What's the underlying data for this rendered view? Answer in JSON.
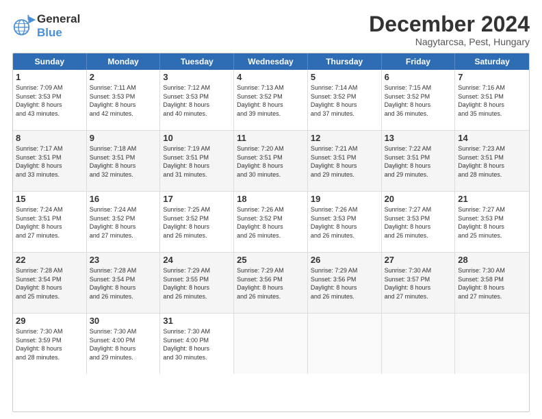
{
  "logo": {
    "line1": "General",
    "line2": "Blue"
  },
  "title": "December 2024",
  "subtitle": "Nagytarcsa, Pest, Hungary",
  "header_days": [
    "Sunday",
    "Monday",
    "Tuesday",
    "Wednesday",
    "Thursday",
    "Friday",
    "Saturday"
  ],
  "rows": [
    [
      {
        "day": "1",
        "info": "Sunrise: 7:09 AM\nSunset: 3:53 PM\nDaylight: 8 hours\nand 43 minutes."
      },
      {
        "day": "2",
        "info": "Sunrise: 7:11 AM\nSunset: 3:53 PM\nDaylight: 8 hours\nand 42 minutes."
      },
      {
        "day": "3",
        "info": "Sunrise: 7:12 AM\nSunset: 3:53 PM\nDaylight: 8 hours\nand 40 minutes."
      },
      {
        "day": "4",
        "info": "Sunrise: 7:13 AM\nSunset: 3:52 PM\nDaylight: 8 hours\nand 39 minutes."
      },
      {
        "day": "5",
        "info": "Sunrise: 7:14 AM\nSunset: 3:52 PM\nDaylight: 8 hours\nand 37 minutes."
      },
      {
        "day": "6",
        "info": "Sunrise: 7:15 AM\nSunset: 3:52 PM\nDaylight: 8 hours\nand 36 minutes."
      },
      {
        "day": "7",
        "info": "Sunrise: 7:16 AM\nSunset: 3:51 PM\nDaylight: 8 hours\nand 35 minutes."
      }
    ],
    [
      {
        "day": "8",
        "info": "Sunrise: 7:17 AM\nSunset: 3:51 PM\nDaylight: 8 hours\nand 33 minutes."
      },
      {
        "day": "9",
        "info": "Sunrise: 7:18 AM\nSunset: 3:51 PM\nDaylight: 8 hours\nand 32 minutes."
      },
      {
        "day": "10",
        "info": "Sunrise: 7:19 AM\nSunset: 3:51 PM\nDaylight: 8 hours\nand 31 minutes."
      },
      {
        "day": "11",
        "info": "Sunrise: 7:20 AM\nSunset: 3:51 PM\nDaylight: 8 hours\nand 30 minutes."
      },
      {
        "day": "12",
        "info": "Sunrise: 7:21 AM\nSunset: 3:51 PM\nDaylight: 8 hours\nand 29 minutes."
      },
      {
        "day": "13",
        "info": "Sunrise: 7:22 AM\nSunset: 3:51 PM\nDaylight: 8 hours\nand 29 minutes."
      },
      {
        "day": "14",
        "info": "Sunrise: 7:23 AM\nSunset: 3:51 PM\nDaylight: 8 hours\nand 28 minutes."
      }
    ],
    [
      {
        "day": "15",
        "info": "Sunrise: 7:24 AM\nSunset: 3:51 PM\nDaylight: 8 hours\nand 27 minutes."
      },
      {
        "day": "16",
        "info": "Sunrise: 7:24 AM\nSunset: 3:52 PM\nDaylight: 8 hours\nand 27 minutes."
      },
      {
        "day": "17",
        "info": "Sunrise: 7:25 AM\nSunset: 3:52 PM\nDaylight: 8 hours\nand 26 minutes."
      },
      {
        "day": "18",
        "info": "Sunrise: 7:26 AM\nSunset: 3:52 PM\nDaylight: 8 hours\nand 26 minutes."
      },
      {
        "day": "19",
        "info": "Sunrise: 7:26 AM\nSunset: 3:53 PM\nDaylight: 8 hours\nand 26 minutes."
      },
      {
        "day": "20",
        "info": "Sunrise: 7:27 AM\nSunset: 3:53 PM\nDaylight: 8 hours\nand 26 minutes."
      },
      {
        "day": "21",
        "info": "Sunrise: 7:27 AM\nSunset: 3:53 PM\nDaylight: 8 hours\nand 25 minutes."
      }
    ],
    [
      {
        "day": "22",
        "info": "Sunrise: 7:28 AM\nSunset: 3:54 PM\nDaylight: 8 hours\nand 25 minutes."
      },
      {
        "day": "23",
        "info": "Sunrise: 7:28 AM\nSunset: 3:54 PM\nDaylight: 8 hours\nand 26 minutes."
      },
      {
        "day": "24",
        "info": "Sunrise: 7:29 AM\nSunset: 3:55 PM\nDaylight: 8 hours\nand 26 minutes."
      },
      {
        "day": "25",
        "info": "Sunrise: 7:29 AM\nSunset: 3:56 PM\nDaylight: 8 hours\nand 26 minutes."
      },
      {
        "day": "26",
        "info": "Sunrise: 7:29 AM\nSunset: 3:56 PM\nDaylight: 8 hours\nand 26 minutes."
      },
      {
        "day": "27",
        "info": "Sunrise: 7:30 AM\nSunset: 3:57 PM\nDaylight: 8 hours\nand 27 minutes."
      },
      {
        "day": "28",
        "info": "Sunrise: 7:30 AM\nSunset: 3:58 PM\nDaylight: 8 hours\nand 27 minutes."
      }
    ],
    [
      {
        "day": "29",
        "info": "Sunrise: 7:30 AM\nSunset: 3:59 PM\nDaylight: 8 hours\nand 28 minutes."
      },
      {
        "day": "30",
        "info": "Sunrise: 7:30 AM\nSunset: 4:00 PM\nDaylight: 8 hours\nand 29 minutes."
      },
      {
        "day": "31",
        "info": "Sunrise: 7:30 AM\nSunset: 4:00 PM\nDaylight: 8 hours\nand 30 minutes."
      },
      {
        "day": "",
        "info": ""
      },
      {
        "day": "",
        "info": ""
      },
      {
        "day": "",
        "info": ""
      },
      {
        "day": "",
        "info": ""
      }
    ]
  ]
}
